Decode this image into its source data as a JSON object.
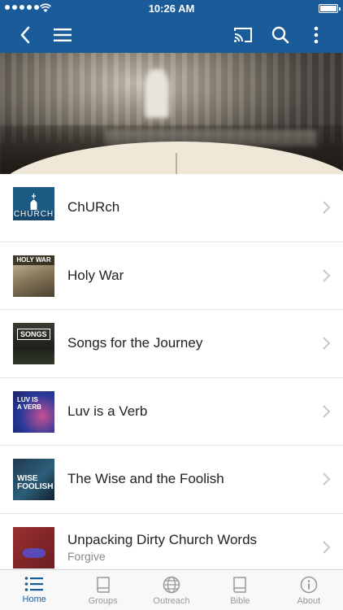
{
  "status": {
    "time": "10:26 AM"
  },
  "list": [
    {
      "title": "ChURch",
      "subtitle": "",
      "thumb_text": "CHURCH"
    },
    {
      "title": "Holy War",
      "subtitle": "",
      "thumb_text": "HOLY WAR"
    },
    {
      "title": "Songs for the Journey",
      "subtitle": "",
      "thumb_text": "SONGS"
    },
    {
      "title": "Luv is a Verb",
      "subtitle": "",
      "thumb_text": "LUV IS A VERB"
    },
    {
      "title": "The Wise and the Foolish",
      "subtitle": "",
      "thumb_text": "WISE FOOLISH"
    },
    {
      "title": "Unpacking Dirty Church Words",
      "subtitle": "Forgive",
      "thumb_text": ""
    }
  ],
  "tabs": [
    {
      "label": "Home",
      "icon": "list-icon",
      "active": true
    },
    {
      "label": "Groups",
      "icon": "book-icon",
      "active": false
    },
    {
      "label": "Outreach",
      "icon": "globe-icon",
      "active": false
    },
    {
      "label": "Bible",
      "icon": "bible-icon",
      "active": false
    },
    {
      "label": "About",
      "icon": "info-icon",
      "active": false
    }
  ],
  "colors": {
    "brand": "#1a5c99",
    "active_tab": "#1a5c99",
    "inactive_tab": "#999999"
  }
}
